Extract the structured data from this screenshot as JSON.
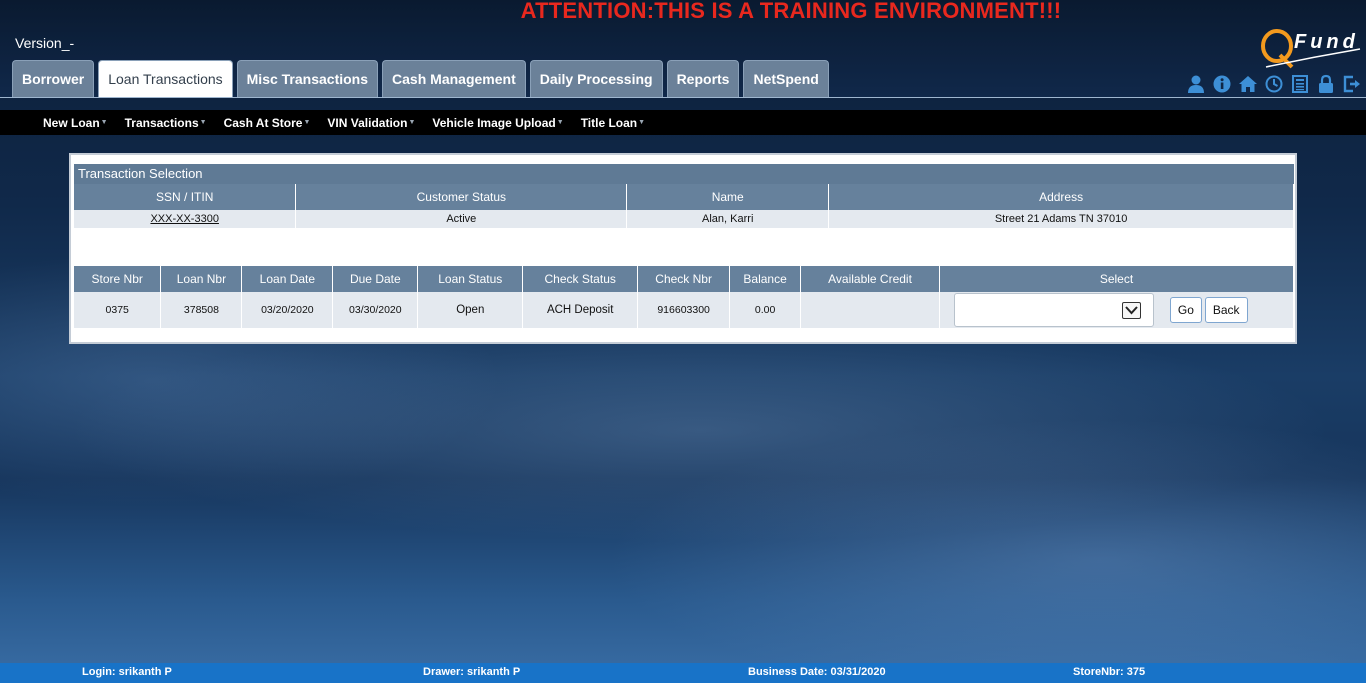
{
  "banner": {
    "attention": "ATTENTION:THIS IS A TRAINING ENVIRONMENT!!!"
  },
  "version": "Version_-",
  "logo": {
    "text": "Fund"
  },
  "tabs": [
    {
      "label": "Borrower"
    },
    {
      "label": "Loan Transactions",
      "active": true
    },
    {
      "label": "Misc Transactions"
    },
    {
      "label": "Cash Management"
    },
    {
      "label": "Daily Processing"
    },
    {
      "label": "Reports"
    },
    {
      "label": "NetSpend"
    }
  ],
  "top_icons": [
    "user-icon",
    "info-icon",
    "home-icon",
    "clock-icon",
    "calculator-icon",
    "lock-icon",
    "logout-icon"
  ],
  "submenu": [
    {
      "label": "New Loan"
    },
    {
      "label": "Transactions"
    },
    {
      "label": "Cash At Store"
    },
    {
      "label": "VIN Validation"
    },
    {
      "label": "Vehicle Image Upload"
    },
    {
      "label": "Title Loan"
    }
  ],
  "panel": {
    "title": "Transaction Selection",
    "customer": {
      "headers": [
        "SSN / ITIN",
        "Customer Status",
        "Name",
        "Address"
      ],
      "row": {
        "ssn": "XXX-XX-3300",
        "status": "Active",
        "name": "Alan,  Karri",
        "address": "Street 21 Adams TN 37010"
      }
    },
    "loans": {
      "headers": [
        "Store Nbr",
        "Loan Nbr",
        "Loan Date",
        "Due Date",
        "Loan Status",
        "Check Status",
        "Check Nbr",
        "Balance",
        "Available Credit",
        "Select"
      ],
      "row": {
        "store_nbr": "0375",
        "loan_nbr": "378508",
        "loan_date": "03/20/2020",
        "due_date": "03/30/2020",
        "loan_status": "Open",
        "check_status": "ACH Deposit",
        "check_nbr": "916603300",
        "balance": "0.00",
        "available_credit": "",
        "select_value": ""
      },
      "go_label": "Go",
      "back_label": "Back"
    }
  },
  "statusbar": {
    "login": "Login: srikanth P",
    "drawer": "Drawer: srikanth P",
    "business_date": "Business Date: 03/31/2020",
    "store": "StoreNbr: 375"
  },
  "colors": {
    "attention": "#e8281e",
    "tab": "#6b8199",
    "table_header": "#66819c",
    "statusbar": "#1873c8"
  }
}
